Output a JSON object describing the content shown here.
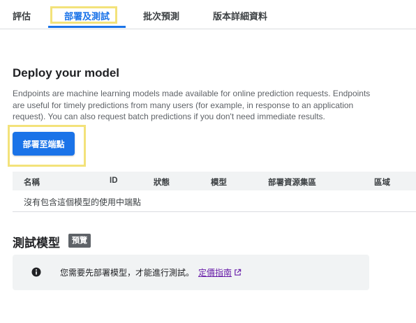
{
  "tabs": [
    {
      "label": "評估"
    },
    {
      "label": "部署及測試"
    },
    {
      "label": "批次預測"
    },
    {
      "label": "版本詳細資料"
    }
  ],
  "deploy": {
    "title": "Deploy your model",
    "description_lines": [
      "Endpoints are machine learning models made available for online prediction requests. Endpoints",
      "are useful for timely predictions from many users (for example, in response to an application",
      "request). You can also request batch predictions if you don't need immediate results."
    ],
    "button_label": "部署至端點"
  },
  "table": {
    "columns": [
      "名稱",
      "ID",
      "狀態",
      "模型",
      "部署資源集區",
      "區域"
    ],
    "empty_message": "沒有包含這個模型的使用中端點"
  },
  "test": {
    "title": "測試模型",
    "badge": "預覽",
    "notice_text": "您需要先部署模型，才能進行測試。",
    "link_label": "定價指南"
  },
  "colors": {
    "accent": "#1a73e8",
    "highlight": "#f3e27a",
    "link_visited": "#681da8",
    "badge_bg": "#5f6368"
  },
  "icons": {
    "notice": "info-icon",
    "link": "external-link-icon"
  }
}
